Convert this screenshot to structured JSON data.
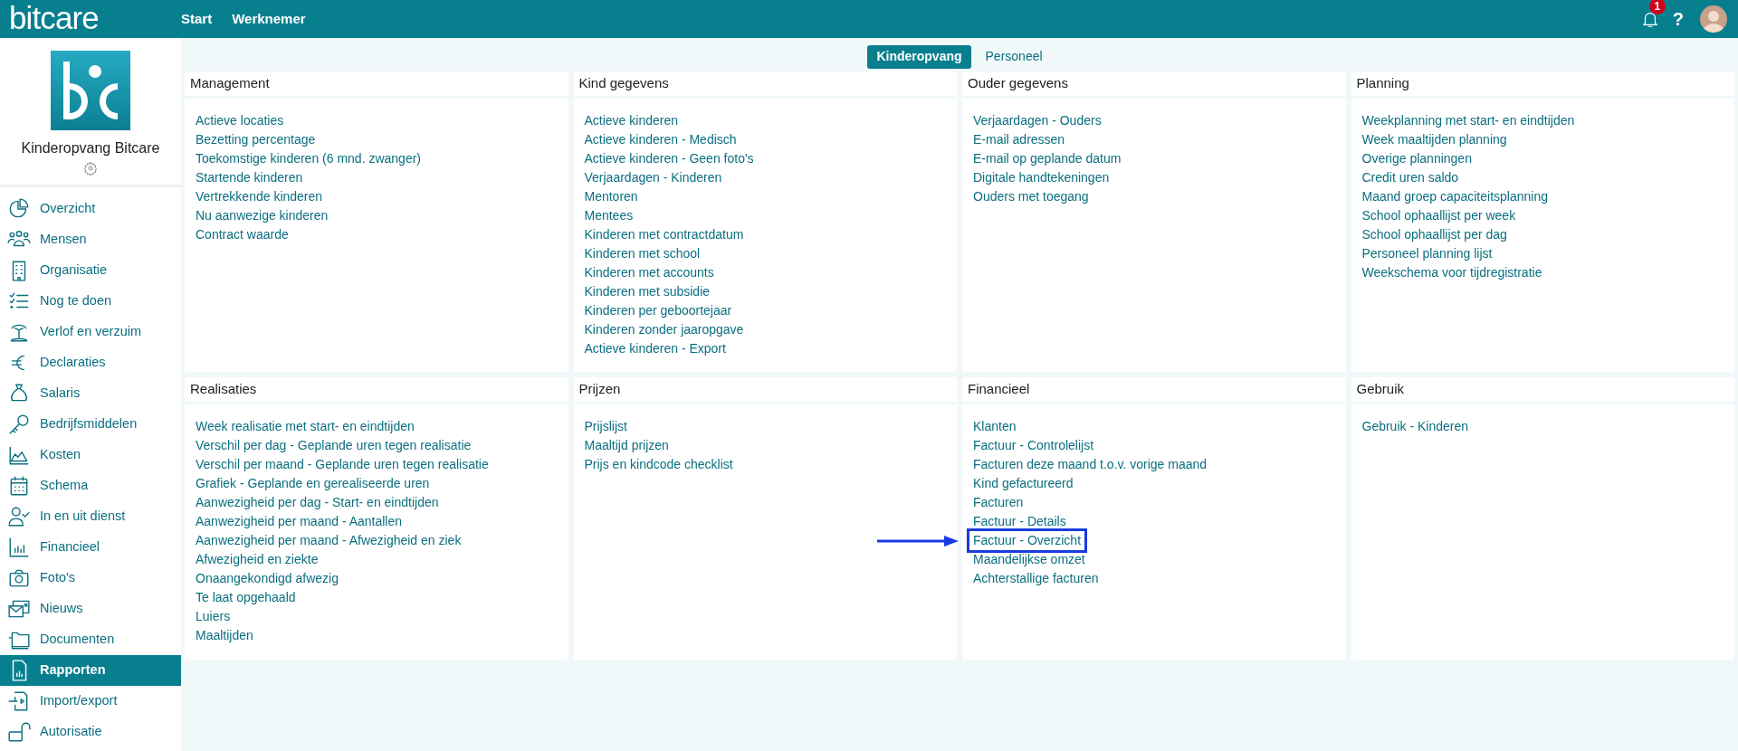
{
  "topbar": {
    "logo": "bitcare",
    "nav": [
      "Start",
      "Werknemer"
    ],
    "notification_count": "1",
    "help": "?"
  },
  "sidebar": {
    "organization": "Kinderopvang Bitcare",
    "items": [
      {
        "label": "Overzicht",
        "selected": false
      },
      {
        "label": "Mensen",
        "selected": false
      },
      {
        "label": "Organisatie",
        "selected": false
      },
      {
        "label": "Nog te doen",
        "selected": false
      },
      {
        "label": "Verlof en verzuim",
        "selected": false
      },
      {
        "label": "Declaraties",
        "selected": false
      },
      {
        "label": "Salaris",
        "selected": false
      },
      {
        "label": "Bedrijfsmiddelen",
        "selected": false
      },
      {
        "label": "Kosten",
        "selected": false
      },
      {
        "label": "Schema",
        "selected": false
      },
      {
        "label": "In en uit dienst",
        "selected": false
      },
      {
        "label": "Financieel",
        "selected": false
      },
      {
        "label": "Foto's",
        "selected": false
      },
      {
        "label": "Nieuws",
        "selected": false
      },
      {
        "label": "Documenten",
        "selected": false
      },
      {
        "label": "Rapporten",
        "selected": true
      },
      {
        "label": "Import/export",
        "selected": false
      },
      {
        "label": "Autorisatie",
        "selected": false
      }
    ]
  },
  "tabs": [
    {
      "label": "Kinderopvang",
      "selected": true
    },
    {
      "label": "Personeel",
      "selected": false
    }
  ],
  "cards": [
    {
      "title": "Management",
      "links": [
        {
          "label": "Actieve locaties",
          "highlighted": false
        },
        {
          "label": "Bezetting percentage",
          "highlighted": false
        },
        {
          "label": "Toekomstige kinderen (6 mnd. zwanger)",
          "highlighted": false
        },
        {
          "label": "Startende kinderen",
          "highlighted": false
        },
        {
          "label": "Vertrekkende kinderen",
          "highlighted": false
        },
        {
          "label": "Nu aanwezige kinderen",
          "highlighted": false
        },
        {
          "label": "Contract waarde",
          "highlighted": false
        }
      ]
    },
    {
      "title": "Kind gegevens",
      "links": [
        {
          "label": "Actieve kinderen",
          "highlighted": false
        },
        {
          "label": "Actieve kinderen - Medisch",
          "highlighted": false
        },
        {
          "label": "Actieve kinderen - Geen foto's",
          "highlighted": false
        },
        {
          "label": "Verjaardagen - Kinderen",
          "highlighted": false
        },
        {
          "label": "Mentoren",
          "highlighted": false
        },
        {
          "label": "Mentees",
          "highlighted": false
        },
        {
          "label": "Kinderen met contractdatum",
          "highlighted": false
        },
        {
          "label": "Kinderen met school",
          "highlighted": false
        },
        {
          "label": "Kinderen met accounts",
          "highlighted": false
        },
        {
          "label": "Kinderen met subsidie",
          "highlighted": false
        },
        {
          "label": "Kinderen per geboortejaar",
          "highlighted": false
        },
        {
          "label": "Kinderen zonder jaaropgave",
          "highlighted": false
        },
        {
          "label": "Actieve kinderen - Export",
          "highlighted": false
        }
      ]
    },
    {
      "title": "Ouder gegevens",
      "links": [
        {
          "label": "Verjaardagen - Ouders",
          "highlighted": false
        },
        {
          "label": "E-mail adressen",
          "highlighted": false
        },
        {
          "label": "E-mail op geplande datum",
          "highlighted": false
        },
        {
          "label": "Digitale handtekeningen",
          "highlighted": false
        },
        {
          "label": "Ouders met toegang",
          "highlighted": false
        }
      ]
    },
    {
      "title": "Planning",
      "links": [
        {
          "label": "Weekplanning met start- en eindtijden",
          "highlighted": false
        },
        {
          "label": "Week maaltijden planning",
          "highlighted": false
        },
        {
          "label": "Overige planningen",
          "highlighted": false
        },
        {
          "label": "Credit uren saldo",
          "highlighted": false
        },
        {
          "label": "Maand groep capaciteitsplanning",
          "highlighted": false
        },
        {
          "label": "School ophaallijst per week",
          "highlighted": false
        },
        {
          "label": "School ophaallijst per dag",
          "highlighted": false
        },
        {
          "label": "Personeel planning lijst",
          "highlighted": false
        },
        {
          "label": "Weekschema voor tijdregistratie",
          "highlighted": false
        }
      ]
    },
    {
      "title": "Realisaties",
      "links": [
        {
          "label": "Week realisatie met start- en eindtijden",
          "highlighted": false
        },
        {
          "label": "Verschil per dag - Geplande uren tegen realisatie",
          "highlighted": false
        },
        {
          "label": "Verschil per maand - Geplande uren tegen realisatie",
          "highlighted": false
        },
        {
          "label": "Grafiek - Geplande en gerealiseerde uren",
          "highlighted": false
        },
        {
          "label": "Aanwezigheid per dag - Start- en eindtijden",
          "highlighted": false
        },
        {
          "label": "Aanwezigheid per maand - Aantallen",
          "highlighted": false
        },
        {
          "label": "Aanwezigheid per maand - Afwezigheid en ziek",
          "highlighted": false
        },
        {
          "label": "Afwezigheid en ziekte",
          "highlighted": false
        },
        {
          "label": "Onaangekondigd afwezig",
          "highlighted": false
        },
        {
          "label": "Te laat opgehaald",
          "highlighted": false
        },
        {
          "label": "Luiers",
          "highlighted": false
        },
        {
          "label": "Maaltijden",
          "highlighted": false
        }
      ]
    },
    {
      "title": "Prijzen",
      "links": [
        {
          "label": "Prijslijst",
          "highlighted": false
        },
        {
          "label": "Maaltijd prijzen",
          "highlighted": false
        },
        {
          "label": "Prijs en kindcode checklist",
          "highlighted": false
        }
      ]
    },
    {
      "title": "Financieel",
      "links": [
        {
          "label": "Klanten",
          "highlighted": false
        },
        {
          "label": "Factuur - Controlelijst",
          "highlighted": false
        },
        {
          "label": "Facturen deze maand t.o.v. vorige maand",
          "highlighted": false
        },
        {
          "label": "Kind gefactureerd",
          "highlighted": false
        },
        {
          "label": "Facturen",
          "highlighted": false
        },
        {
          "label": "Factuur - Details",
          "highlighted": false
        },
        {
          "label": "Factuur - Overzicht",
          "highlighted": true
        },
        {
          "label": "Maandelijkse omzet",
          "highlighted": false
        },
        {
          "label": "Achterstallige facturen",
          "highlighted": false
        }
      ]
    },
    {
      "title": "Gebruik",
      "links": [
        {
          "label": "Gebruik - Kinderen",
          "highlighted": false
        }
      ]
    }
  ]
}
